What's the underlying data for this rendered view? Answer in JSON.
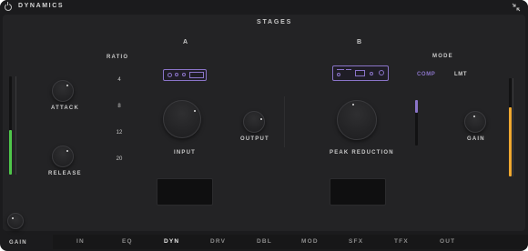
{
  "window": {
    "title": "DYNAMICS"
  },
  "colors": {
    "accent": "#8a74c8",
    "meter_green": "#4fc74a",
    "meter_orange": "#f0a830",
    "background": "#232325"
  },
  "header": {
    "stages_label": "STAGES",
    "stage_a": "A",
    "stage_b": "B"
  },
  "left": {
    "attack_label": "ATTACK",
    "release_label": "RELEASE"
  },
  "ratio": {
    "label": "RATIO",
    "values": [
      "4",
      "8",
      "12",
      "20"
    ]
  },
  "stage_a": {
    "input_label": "INPUT",
    "output_label": "OUTPUT"
  },
  "stage_b": {
    "peak_reduction_label": "PEAK REDUCTION"
  },
  "mode": {
    "label": "MODE",
    "comp": "COMP",
    "lmt": "LMT",
    "selected": "COMP"
  },
  "right": {
    "gain_label": "GAIN"
  },
  "meters": {
    "left_level": 0.45,
    "right_level": 0.7
  },
  "footer": {
    "gain_label": "GAIN",
    "tabs": [
      "IN",
      "EQ",
      "DYN",
      "DRV",
      "DBL",
      "MOD",
      "SFX",
      "TFX",
      "OUT"
    ],
    "active_tab": "DYN"
  }
}
